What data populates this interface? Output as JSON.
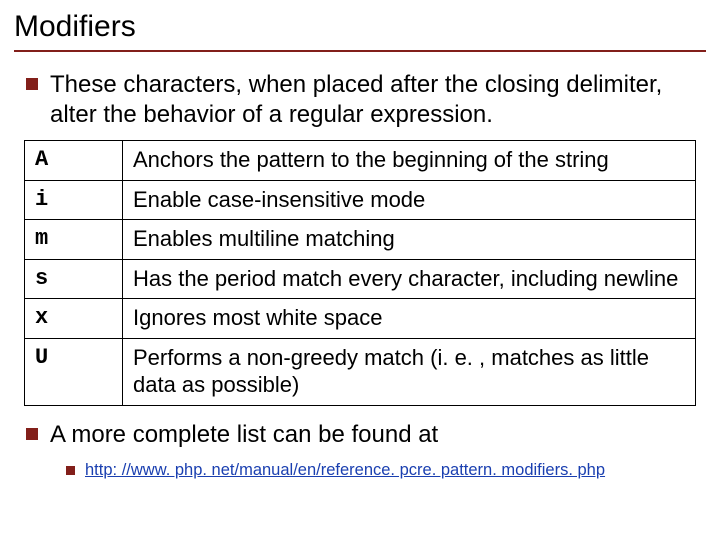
{
  "title": "Modifiers",
  "bullets": {
    "intro": "These characters, when placed after the closing delimiter, alter the behavior of a regular expression.",
    "outro": "A more complete list can be found at",
    "link": "http: //www. php. net/manual/en/reference. pcre. pattern. modifiers. php"
  },
  "table": {
    "rows": [
      {
        "mod": "A",
        "desc": "Anchors the pattern to the beginning of the string"
      },
      {
        "mod": "i",
        "desc": "Enable case-insensitive mode"
      },
      {
        "mod": "m",
        "desc": "Enables multiline matching"
      },
      {
        "mod": "s",
        "desc": "Has the period match every character, including newline"
      },
      {
        "mod": "x",
        "desc": "Ignores most white space"
      },
      {
        "mod": "U",
        "desc": "Performs a non-greedy match (i. e. , matches as little data as possible)"
      }
    ]
  }
}
